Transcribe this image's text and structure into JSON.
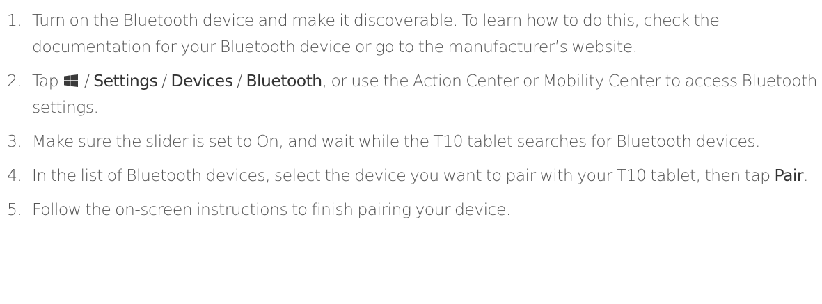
{
  "steps": [
    {
      "number": "1.",
      "text": "Turn on the Bluetooth device and make it discoverable. To learn how to do this, check the documentation for your Bluetooth device or go to the manufacturer’s website."
    },
    {
      "number": "2.",
      "prefix": "Tap",
      "icon": "windows-icon",
      "sep": "/",
      "path": [
        "Settings",
        "Devices",
        "Bluetooth"
      ],
      "suffix": ", or use the Action Center or Mobility Center to access Bluetooth settings."
    },
    {
      "number": "3.",
      "text": "Make sure the slider is set to On, and wait while the T10 tablet searches for Bluetooth devices."
    },
    {
      "number": "4.",
      "text": "In the list of Bluetooth devices, select the device you want to pair with your T10 tablet, then tap",
      "action": "Pair",
      "end": "."
    },
    {
      "number": "5.",
      "text": "Follow the on-screen instructions to finish pairing your device."
    }
  ]
}
